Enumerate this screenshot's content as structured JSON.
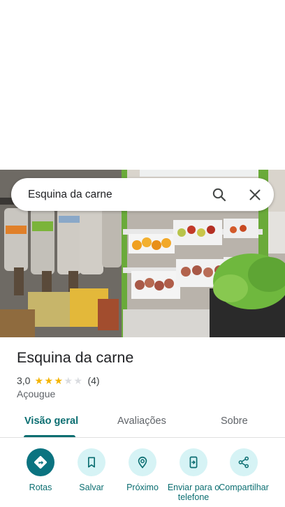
{
  "search": {
    "query": "Esquina da carne",
    "search_icon": "search-icon",
    "clear_icon": "close-icon"
  },
  "place": {
    "name": "Esquina da carne",
    "rating": "3,0",
    "stars_filled": 3,
    "stars_total": 5,
    "review_count": "(4)",
    "category": "Açougue"
  },
  "tabs": [
    {
      "label": "Visão geral",
      "active": true
    },
    {
      "label": "Avaliações",
      "active": false
    },
    {
      "label": "Sobre",
      "active": false
    }
  ],
  "actions": [
    {
      "label": "Rotas",
      "icon": "directions-icon"
    },
    {
      "label": "Salvar",
      "icon": "bookmark-icon"
    },
    {
      "label": "Próximo",
      "icon": "nearby-icon"
    },
    {
      "label": "Enviar para o telefone",
      "icon": "send-to-phone-icon"
    },
    {
      "label": "Compartilhar",
      "icon": "share-icon"
    }
  ],
  "colors": {
    "accent": "#0b6e71",
    "primary_button": "#0b7380",
    "action_bg": "#d6f3f5",
    "star": "#f4b400"
  }
}
